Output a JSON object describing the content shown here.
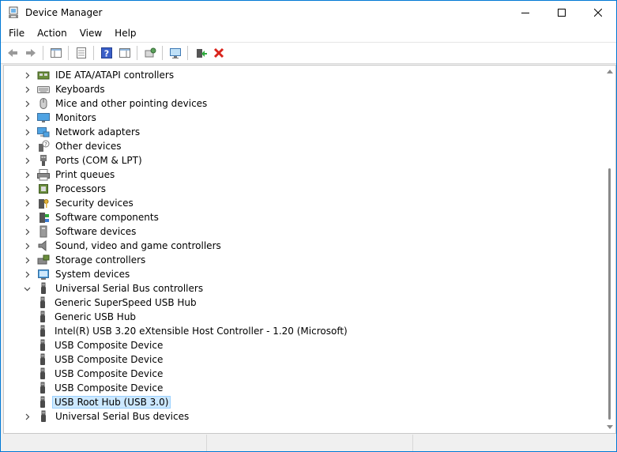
{
  "window": {
    "title": "Device Manager",
    "controls": {
      "minimize": "minimize",
      "maximize": "maximize",
      "close": "close"
    }
  },
  "menubar": {
    "items": [
      "File",
      "Action",
      "View",
      "Help"
    ]
  },
  "toolbar": {
    "buttons": [
      "back-arrow-icon",
      "forward-arrow-icon",
      "sep",
      "properties-list-icon",
      "sep",
      "console-tree-icon",
      "sep",
      "help-icon",
      "action-pane-icon",
      "sep",
      "scan-hardware-icon",
      "sep",
      "monitor-update-icon",
      "sep",
      "update-driver-icon",
      "uninstall-icon"
    ]
  },
  "tree": {
    "rows": [
      {
        "label": "IDE ATA/ATAPI controllers",
        "icon": "ide-controller-icon",
        "level": 0,
        "state": "collapsed"
      },
      {
        "label": "Keyboards",
        "icon": "keyboard-icon",
        "level": 0,
        "state": "collapsed"
      },
      {
        "label": "Mice and other pointing devices",
        "icon": "mouse-icon",
        "level": 0,
        "state": "collapsed"
      },
      {
        "label": "Monitors",
        "icon": "monitor-icon",
        "level": 0,
        "state": "collapsed"
      },
      {
        "label": "Network adapters",
        "icon": "network-adapter-icon",
        "level": 0,
        "state": "collapsed"
      },
      {
        "label": "Other devices",
        "icon": "unknown-device-icon",
        "level": 0,
        "state": "collapsed"
      },
      {
        "label": "Ports (COM & LPT)",
        "icon": "port-icon",
        "level": 0,
        "state": "collapsed"
      },
      {
        "label": "Print queues",
        "icon": "printer-icon",
        "level": 0,
        "state": "collapsed"
      },
      {
        "label": "Processors",
        "icon": "processor-icon",
        "level": 0,
        "state": "collapsed"
      },
      {
        "label": "Security devices",
        "icon": "security-device-icon",
        "level": 0,
        "state": "collapsed"
      },
      {
        "label": "Software components",
        "icon": "software-component-icon",
        "level": 0,
        "state": "collapsed"
      },
      {
        "label": "Software devices",
        "icon": "software-device-icon",
        "level": 0,
        "state": "collapsed"
      },
      {
        "label": "Sound, video and game controllers",
        "icon": "speaker-icon",
        "level": 0,
        "state": "collapsed"
      },
      {
        "label": "Storage controllers",
        "icon": "storage-controller-icon",
        "level": 0,
        "state": "collapsed"
      },
      {
        "label": "System devices",
        "icon": "system-device-icon",
        "level": 0,
        "state": "collapsed"
      },
      {
        "label": "Universal Serial Bus controllers",
        "icon": "usb-icon",
        "level": 0,
        "state": "expanded"
      },
      {
        "label": "Generic SuperSpeed USB Hub",
        "icon": "usb-icon",
        "level": 1,
        "state": "leaf"
      },
      {
        "label": "Generic USB Hub",
        "icon": "usb-icon",
        "level": 1,
        "state": "leaf"
      },
      {
        "label": "Intel(R) USB 3.20 eXtensible Host Controller - 1.20 (Microsoft)",
        "icon": "usb-icon",
        "level": 1,
        "state": "leaf"
      },
      {
        "label": "USB Composite Device",
        "icon": "usb-icon",
        "level": 1,
        "state": "leaf"
      },
      {
        "label": "USB Composite Device",
        "icon": "usb-icon",
        "level": 1,
        "state": "leaf"
      },
      {
        "label": "USB Composite Device",
        "icon": "usb-icon",
        "level": 1,
        "state": "leaf"
      },
      {
        "label": "USB Composite Device",
        "icon": "usb-icon",
        "level": 1,
        "state": "leaf"
      },
      {
        "label": "USB Root Hub (USB 3.0)",
        "icon": "usb-icon",
        "level": 1,
        "state": "leaf",
        "selected": true
      },
      {
        "label": "Universal Serial Bus devices",
        "icon": "usb-icon",
        "level": 0,
        "state": "collapsed"
      }
    ]
  },
  "colors": {
    "accent": "#0078d4",
    "selection_bg": "#cce8ff",
    "selection_border": "#99d1ff"
  }
}
